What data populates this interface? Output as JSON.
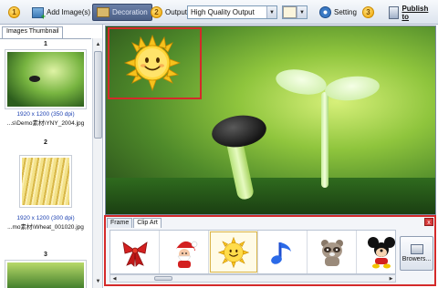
{
  "toolbar": {
    "steps": [
      "1",
      "2",
      "3",
      "4"
    ],
    "add_images_label": "Add Image(s)",
    "decoration_label": "Decoration",
    "output_label": "Output:",
    "output_value": "High Quality Output",
    "setting_label": "Setting",
    "publish_label": "Publish to"
  },
  "left_panel": {
    "tab_label": "Images Thumbnail",
    "items": [
      {
        "num": "1",
        "dim": "1920 x 1200 (350 dpi)",
        "path": "...s\\Demo素材\\YNY_2004.jpg"
      },
      {
        "num": "2",
        "dim": "1920 x 1200 (300 dpi)",
        "path": "...mo素材\\Wheat_001020.jpg"
      },
      {
        "num": "3"
      }
    ]
  },
  "clip_panel": {
    "tabs": [
      "Frame",
      "Clip Art"
    ],
    "close_label": "x",
    "items": [
      "ribbon-bow",
      "santa",
      "sun",
      "music-note",
      "raccoon",
      "mickey-mouse"
    ],
    "browse_label": "Browers..."
  },
  "colors": {
    "highlight": "#d42a2a",
    "toolbar_active": "#4b5f86",
    "link_blue": "#1a3fb0"
  }
}
